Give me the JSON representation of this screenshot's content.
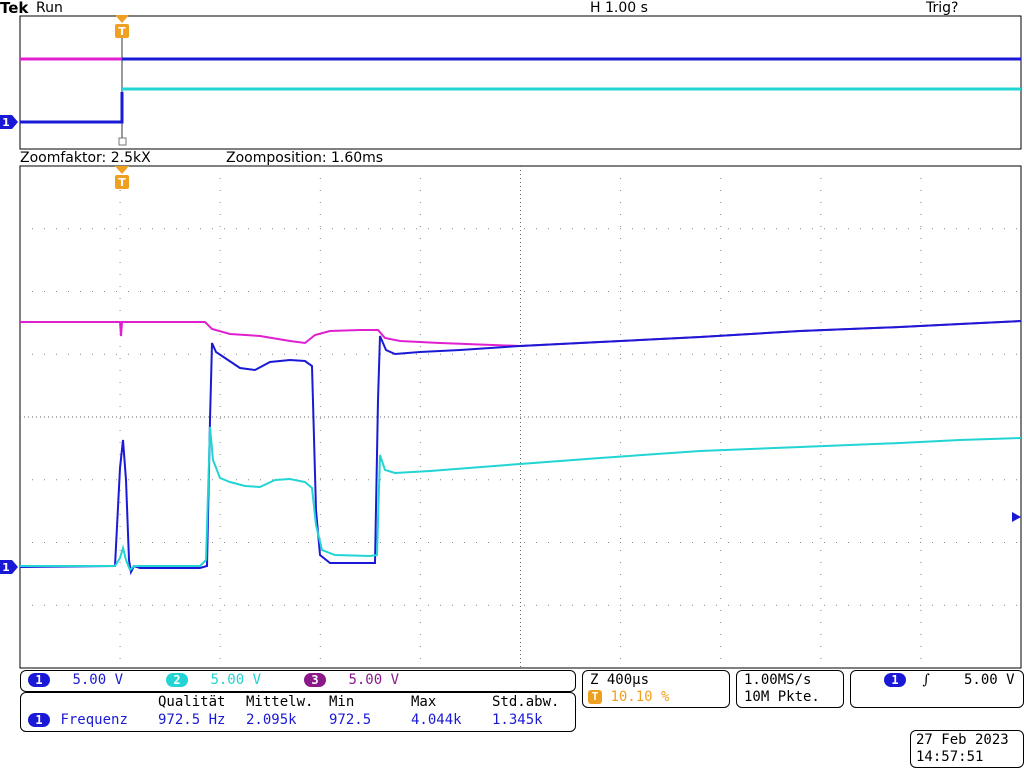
{
  "header": {
    "brand": "Tek",
    "state": "Run",
    "timebase": "H 1.00 s",
    "trigger_status": "Trig?"
  },
  "zoom": {
    "factor_label": "Zoomfaktor: 2.5kX",
    "position_label": "Zoomposition: 1.60ms"
  },
  "markers": {
    "trigger_marker": "T",
    "channel_marker": "1"
  },
  "channels": [
    {
      "id": "1",
      "scale": "5.00 V",
      "color": "#1a1ad6"
    },
    {
      "id": "2",
      "scale": "5.00 V",
      "color": "#22d4d4"
    },
    {
      "id": "3",
      "scale": "5.00 V",
      "color": "#8a1a8a"
    }
  ],
  "trace_colors": {
    "ch1": "#1a1ad6",
    "ch2": "#22d4d4",
    "ref": "#e020d0",
    "trigger": "#f0a020"
  },
  "measurement": {
    "headers": [
      "Qualität",
      "Mittelw.",
      "Min",
      "Max",
      "Std.abw."
    ],
    "channel": "1",
    "name": "Frequenz",
    "values": [
      "972.5 Hz",
      "2.095k",
      "972.5",
      "4.044k",
      "1.345k"
    ]
  },
  "horizontal": {
    "zoom_scale": "Z 400µs",
    "trigger_pos_marker": "T",
    "trigger_pos": "10.10 %"
  },
  "acquisition": {
    "sample_rate": "1.00MS/s",
    "record_length": "10M Pkte."
  },
  "trigger": {
    "source": "1",
    "slope_symbol": "∫",
    "level": "5.00 V"
  },
  "datetime": {
    "date": "27 Feb  2023",
    "time": "14:57:51"
  }
}
